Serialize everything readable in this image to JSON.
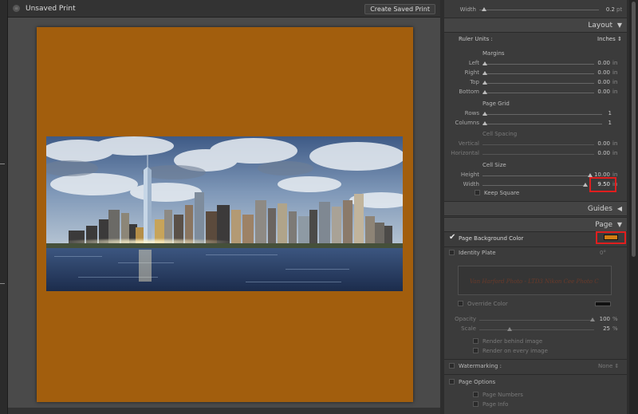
{
  "window": {
    "title": "Unsaved Print",
    "save_button": "Create Saved Print"
  },
  "colors": {
    "page_background": "#a25e0d",
    "swatch": "#d07d12",
    "highlight": "#e01e1e"
  },
  "panel": {
    "width_row": {
      "label": "Width",
      "value": "0.2",
      "unit": "pt"
    },
    "layout": {
      "header": "Layout",
      "ruler_units_label": "Ruler Units :",
      "ruler_units_value": "Inches",
      "margins_heading": "Margins",
      "margins": [
        {
          "label": "Left",
          "value": "0.00",
          "unit": "in"
        },
        {
          "label": "Right",
          "value": "0.00",
          "unit": "in"
        },
        {
          "label": "Top",
          "value": "0.00",
          "unit": "in"
        },
        {
          "label": "Bottom",
          "value": "0.00",
          "unit": "in"
        }
      ],
      "page_grid_heading": "Page Grid",
      "page_grid": [
        {
          "label": "Rows",
          "value": "1"
        },
        {
          "label": "Columns",
          "value": "1"
        }
      ],
      "cell_spacing_heading": "Cell Spacing",
      "cell_spacing": [
        {
          "label": "Vertical",
          "value": "0.00",
          "unit": "in"
        },
        {
          "label": "Horizontal",
          "value": "0.00",
          "unit": "in"
        }
      ],
      "cell_size_heading": "Cell Size",
      "cell_size": [
        {
          "label": "Height",
          "value": "10.00",
          "unit": "in"
        },
        {
          "label": "Width",
          "value": "9.50",
          "unit": "in"
        }
      ],
      "keep_square": "Keep Square"
    },
    "guides": {
      "header": "Guides"
    },
    "page": {
      "header": "Page",
      "page_background_color": "Page Background Color",
      "identity_plate": "Identity Plate",
      "identity_plate_angle": "0°",
      "identity_plate_text": "Van Harford Photo - LTD3 Nikon Cee Photo C",
      "override_color": "Override Color",
      "opacity_label": "Opacity",
      "opacity_value": "100",
      "opacity_unit": "%",
      "scale_label": "Scale",
      "scale_value": "25",
      "scale_unit": "%",
      "render_behind": "Render behind image",
      "render_every": "Render on every image",
      "watermarking_label": "Watermarking :",
      "watermarking_value": "None",
      "page_options": "Page Options",
      "page_numbers": "Page Numbers",
      "page_info": "Page Info"
    }
  }
}
